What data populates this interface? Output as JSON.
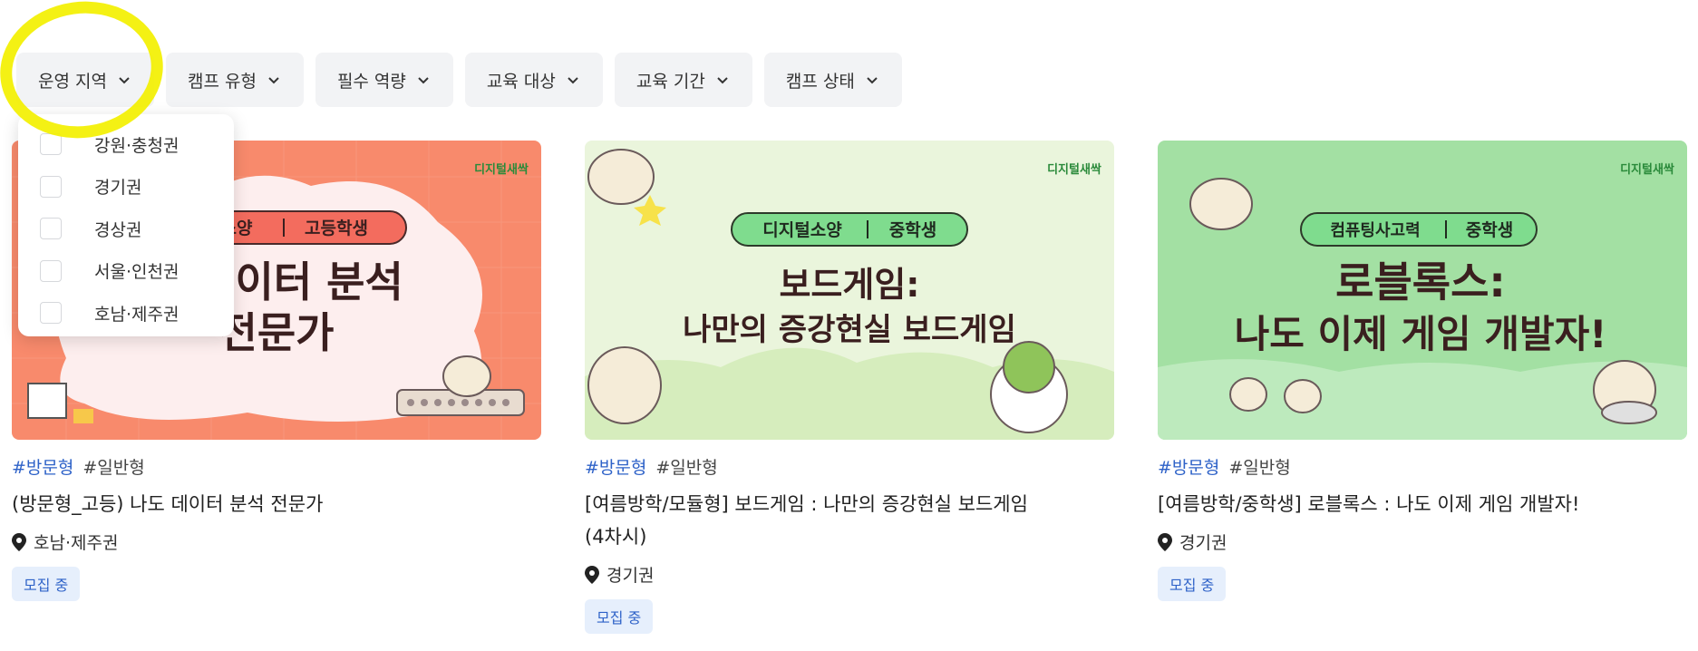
{
  "filters": [
    {
      "label": "운영 지역"
    },
    {
      "label": "캠프 유형"
    },
    {
      "label": "필수 역량"
    },
    {
      "label": "교육 대상"
    },
    {
      "label": "교육 기간"
    },
    {
      "label": "캠프 상태"
    }
  ],
  "region_dropdown": {
    "options": [
      "강원·충청권",
      "경기권",
      "경상권",
      "서울·인천권",
      "호남·제주권"
    ]
  },
  "cards": [
    {
      "thumb": {
        "brand": "디지털새싹",
        "pill_left": "소양",
        "pill_right": "고등학생",
        "line1": "데이터 분석",
        "line2": "전문가"
      },
      "tag1": "#방문형",
      "tag2": "#일반형",
      "title": "(방문형_고등) 나도 데이터 분석 전문가",
      "location": "호남·제주권",
      "status": "모집 중"
    },
    {
      "thumb": {
        "brand": "디지털새싹",
        "pill_left": "디지털소양",
        "pill_right": "중학생",
        "line1": "보드게임:",
        "line2": "나만의 증강현실 보드게임"
      },
      "tag1": "#방문형",
      "tag2": "#일반형",
      "title_line1": "[여름방학/모듈형] 보드게임 : 나만의 증강현실 보드게임",
      "title_line2": "(4차시)",
      "location": "경기권",
      "status": "모집 중"
    },
    {
      "thumb": {
        "brand": "디지털새싹",
        "pill_left": "컴퓨팅사고력",
        "pill_right": "중학생",
        "line1": "로블록스:",
        "line2": "나도 이제 게임 개발자!"
      },
      "tag1": "#방문형",
      "tag2": "#일반형",
      "title": "[여름방학/중학생] 로블록스 : 나도 이제 게임 개발자!",
      "location": "경기권",
      "status": "모집 중"
    }
  ],
  "colors": {
    "card1_bg": "#f88a6c",
    "card2_bg": "#eaf5dc",
    "card3_bg": "#a3e0a3",
    "accent_blue": "#2e62c8",
    "highlight": "#f3f000"
  },
  "icons": {
    "chevron": "chevron-down-icon",
    "location": "map-pin-icon"
  }
}
